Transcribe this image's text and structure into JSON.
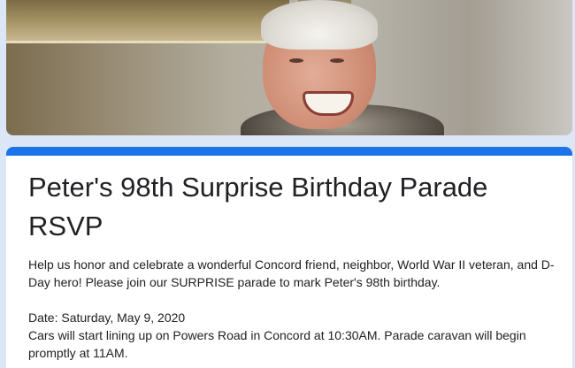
{
  "form": {
    "title": "Peter's 98th Surprise Birthday Parade RSVP",
    "description": "Help us honor and celebrate a wonderful Concord friend, neighbor, World War II veteran, and D-Day hero! Please join our SURPRISE parade to mark Peter's 98th birthday.\n\nDate: Saturday, May 9, 2020\nCars will start lining up on Powers Road in Concord at 10:30AM. Parade caravan will begin promptly at 11AM."
  },
  "colors": {
    "accent": "#1a73e8",
    "page_background": "#dbe6f6"
  }
}
